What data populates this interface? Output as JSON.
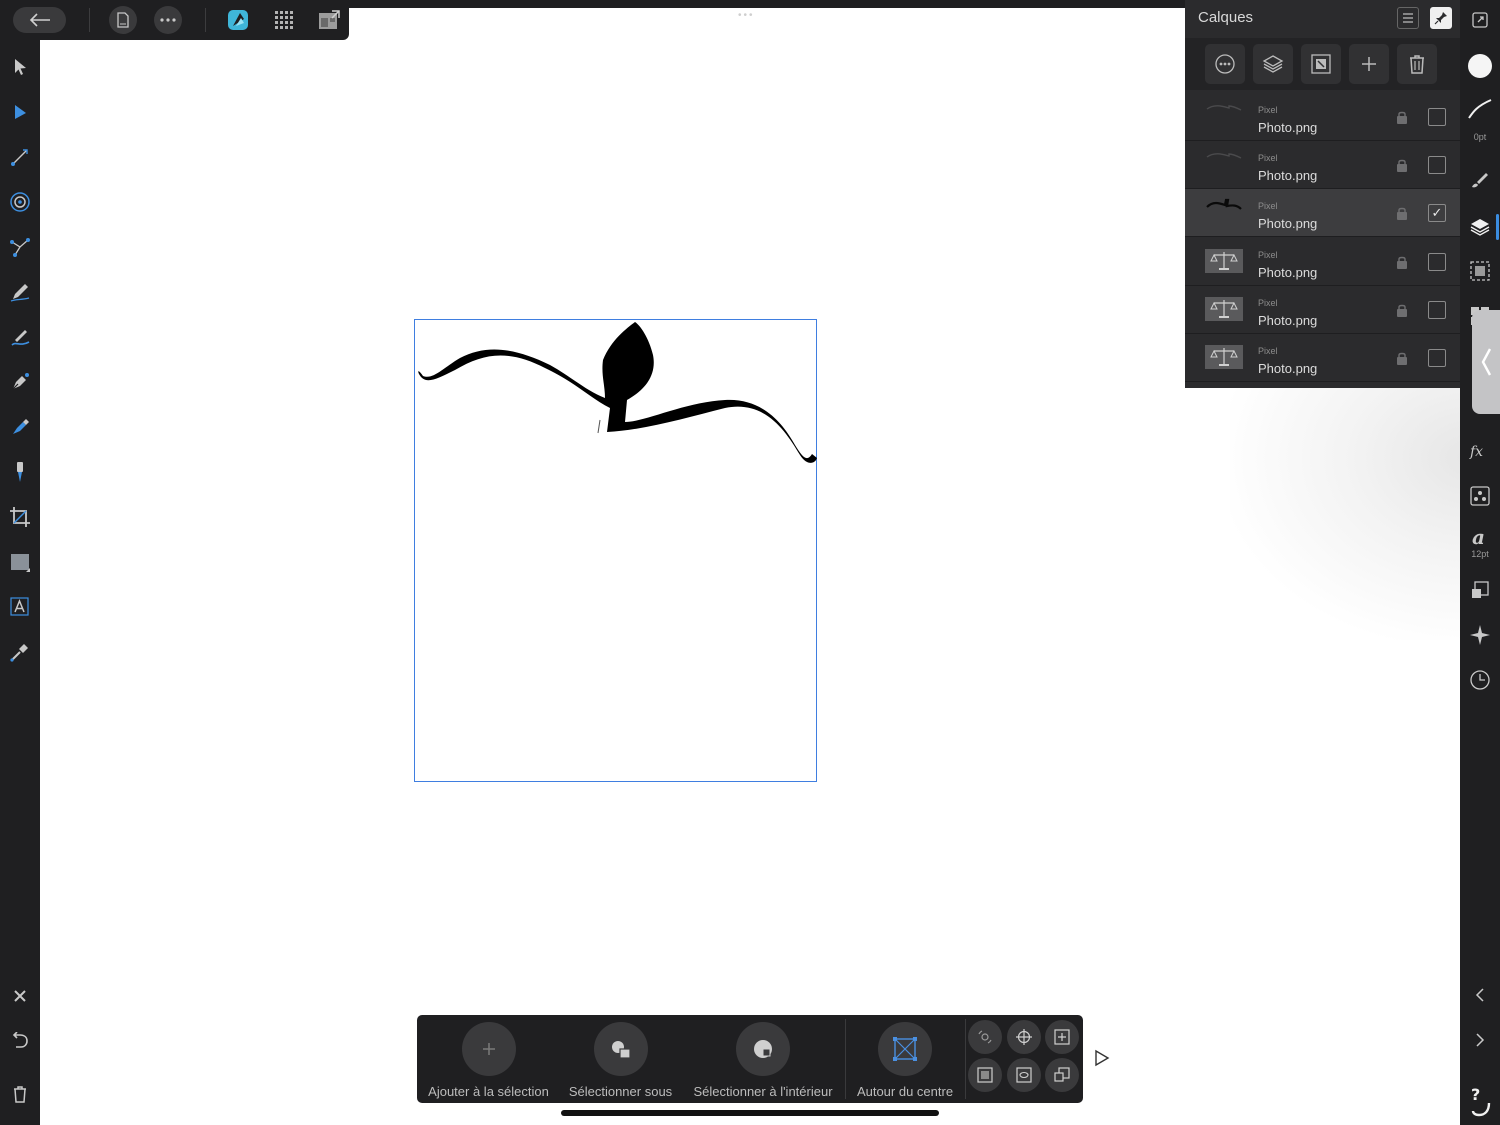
{
  "topbar": {
    "back_icon": "arrow-left-icon",
    "document_icon": "document-icon",
    "more_icon": "ellipsis-icon",
    "personas": [
      "designer-persona-icon",
      "pixel-persona-icon",
      "export-persona-icon"
    ]
  },
  "left_tools": [
    "move-tool-icon",
    "node-tool-icon",
    "gradient-tool-icon",
    "transparency-tool-icon",
    "vector-crop-icon",
    "pencil-tool-icon",
    "vector-brush-icon",
    "pen-tool-icon",
    "fill-tool-icon",
    "place-image-icon",
    "crop-tool-icon",
    "rectangle-tool-icon",
    "text-tool-icon",
    "color-picker-icon"
  ],
  "left_bottom": [
    "close-icon",
    "undo-icon",
    "trash-icon"
  ],
  "layers_panel": {
    "title": "Calques",
    "toolbar_icons": [
      "blend-options-icon",
      "layer-stack-icon",
      "mask-icon",
      "add-layer-icon",
      "delete-layer-icon"
    ],
    "layers": [
      {
        "type": "Pixel",
        "name": "Photo.png",
        "selected": false,
        "checked": false,
        "thumb": "stroke-faint"
      },
      {
        "type": "Pixel",
        "name": "Photo.png",
        "selected": false,
        "checked": false,
        "thumb": "stroke-faint"
      },
      {
        "type": "Pixel",
        "name": "Photo.png",
        "selected": true,
        "checked": true,
        "thumb": "stroke-dark"
      },
      {
        "type": "Pixel",
        "name": "Photo.png",
        "selected": false,
        "checked": false,
        "thumb": "scale-photo"
      },
      {
        "type": "Pixel",
        "name": "Photo.png",
        "selected": false,
        "checked": false,
        "thumb": "scale-photo"
      },
      {
        "type": "Pixel",
        "name": "Photo.png",
        "selected": false,
        "checked": false,
        "thumb": "scale-photo"
      }
    ]
  },
  "right_studio": {
    "stroke_width": "0pt",
    "font_size": "12pt",
    "icons": [
      "color-icon",
      "stroke-icon",
      "brushes-icon",
      "layers-icon",
      "selection-icon",
      "swatches-icon",
      "fx-icon",
      "adjustments-icon",
      "text-styles-icon",
      "transform-icon",
      "navigator-icon",
      "history-icon"
    ],
    "bottom": [
      "chevron-left-icon",
      "chevron-right-icon",
      "help-icon"
    ]
  },
  "context_toolbar": {
    "add_to_selection": "Ajouter à la sélection",
    "select_under": "Sélectionner sous",
    "select_inside": "Sélectionner à l'intérieur",
    "around_center": "Autour du centre"
  },
  "colors": {
    "chrome": "#1f1f21",
    "panel": "#2b2b2d",
    "accent": "#3b8de0",
    "artboard_border": "#3f7ee0"
  }
}
